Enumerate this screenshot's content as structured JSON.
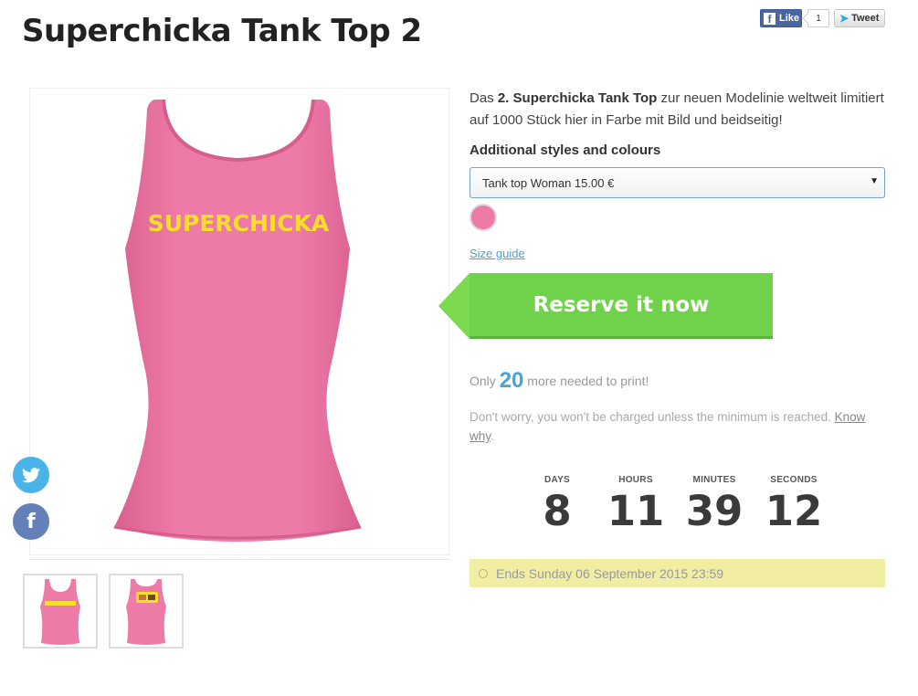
{
  "product": {
    "title": "Superchicka Tank Top 2",
    "shirt_text": "SUPERCHICKA",
    "shirt_color": "#ee7aa8",
    "text_color": "#f6de2a"
  },
  "social": {
    "fb_like_label": "Like",
    "fb_count": "1",
    "tweet_label": "Tweet",
    "side_icons": [
      "twitter-icon",
      "facebook-icon"
    ]
  },
  "description": {
    "prefix": "Das ",
    "bold": "2. Superchicka Tank Top",
    "suffix": " zur neuen Modelinie weltweit limitiert auf 1000 Stück hier in Farbe mit Bild und beidseitig!"
  },
  "styles": {
    "label": "Additional styles and colours",
    "selected": "Tank top Woman 15.00 €",
    "swatch_color": "#ee7aa8"
  },
  "size_guide": "Size guide",
  "reserve": {
    "label": "Reserve it now",
    "color": "#6fd24a"
  },
  "needed": {
    "prefix": "Only ",
    "count": "20",
    "suffix": " more needed to print!"
  },
  "worry": {
    "text": "Don't worry, you won't be charged unless the minimum is reached. ",
    "link": "Know why",
    "end": "."
  },
  "countdown": {
    "days_label": "DAYS",
    "days": "8",
    "hours_label": "HOURS",
    "hours": "11",
    "minutes_label": "MINUTES",
    "minutes": "39",
    "seconds_label": "SECONDS",
    "seconds": "12"
  },
  "ends": {
    "text": "Ends Sunday 06 September 2015 23:59"
  }
}
